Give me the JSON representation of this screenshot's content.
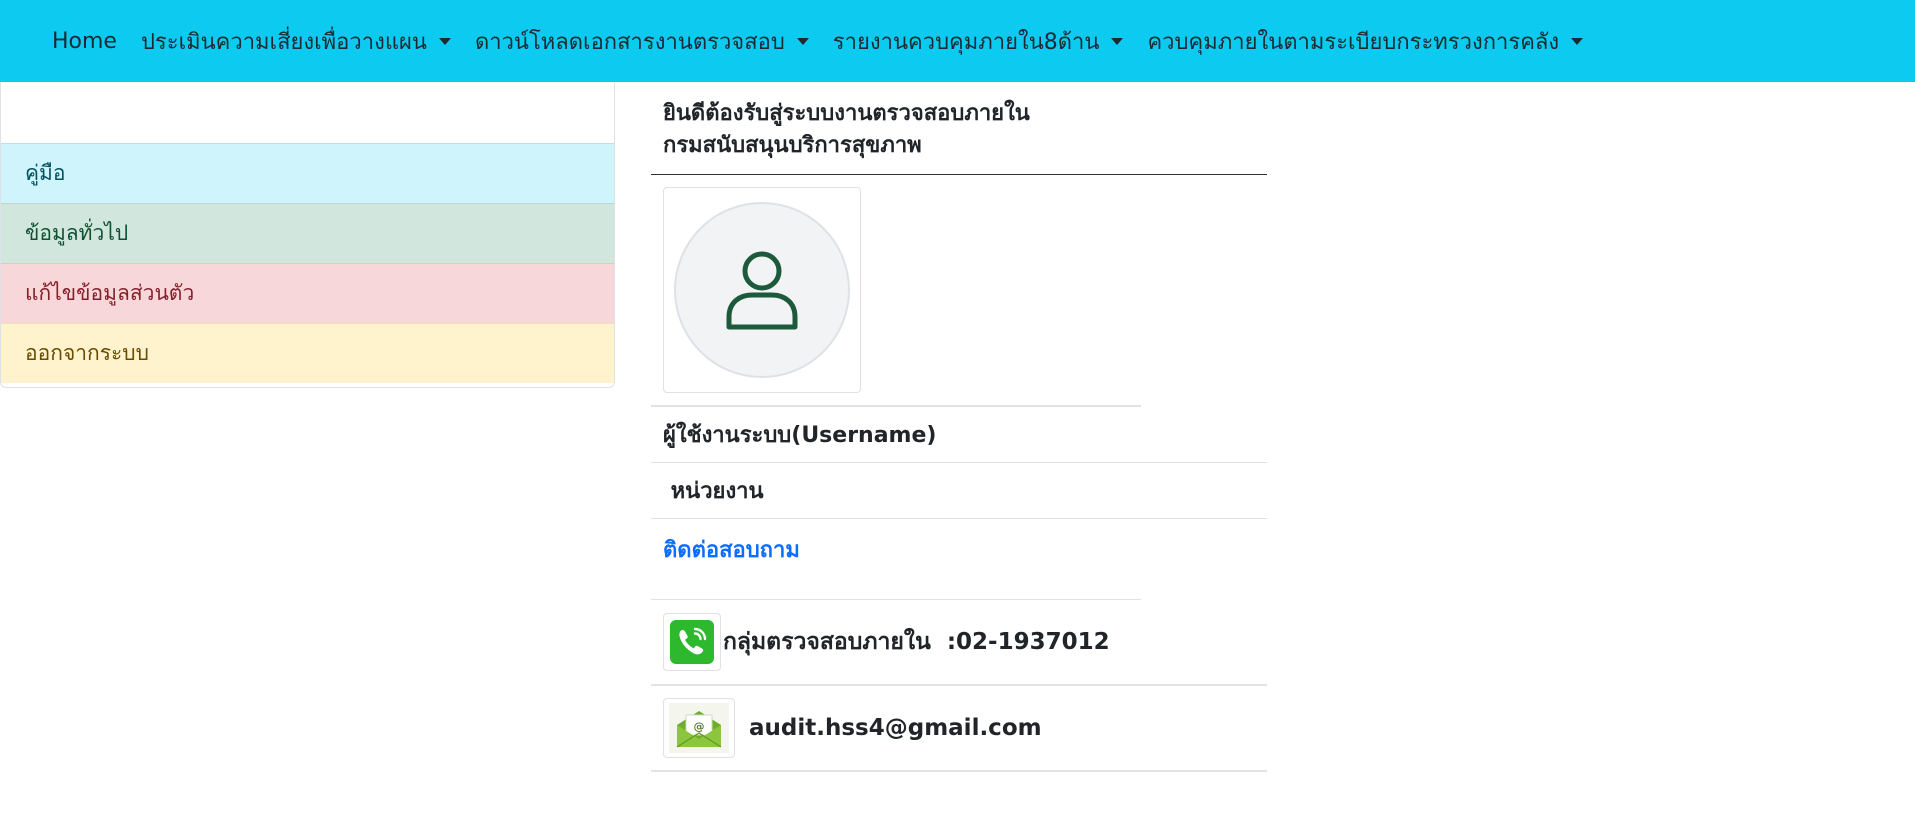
{
  "navbar": {
    "background": "#0dcaf0",
    "items": [
      {
        "label": "Home",
        "dropdown": false
      },
      {
        "label": "ประเมินความเสี่ยงเพื่อวางแผน",
        "dropdown": true
      },
      {
        "label": "ดาวน์โหลดเอกสารงานตรวจสอบ",
        "dropdown": true
      },
      {
        "label": "รายงานควบคุมภายใน8ด้าน",
        "dropdown": true
      },
      {
        "label": "ควบคุมภายในตามระเบียบกระทรวงการคลัง",
        "dropdown": true
      }
    ]
  },
  "sidebar": {
    "items": [
      {
        "label": "คู่มือ",
        "color": "#cff4fc"
      },
      {
        "label": "ข้อมูลทั่วไป",
        "color": "#d1e7dd"
      },
      {
        "label": "แก้ไขข้อมูลส่วนตัว",
        "color": "#f8d7da"
      },
      {
        "label": "ออกจากระบบ",
        "color": "#fff3cd"
      }
    ]
  },
  "main": {
    "welcome_line1": "ยินดีต้องรับสู่ระบบงานตรวจสอบภายใน",
    "welcome_line2": "กรมสนับสนุนบริการสุขภาพ",
    "avatar_icon": "user-icon",
    "username_label": "ผู้ใช้งานระบบ(Username)",
    "department_label": " หน่วยงาน",
    "contact_link": "ติดต่อสอบถาม",
    "phone_icon": "phone-icon",
    "phone_text": "กลุ่มตรวจสอบภายใน  :02-1937012",
    "email_icon": "email-icon",
    "email_text": "audit.hss4@gmail.com"
  }
}
